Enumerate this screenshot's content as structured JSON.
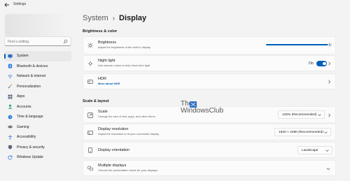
{
  "window": {
    "title": "Settings"
  },
  "search": {
    "placeholder": "Find a setting"
  },
  "sidebar": {
    "items": [
      {
        "label": "System",
        "icon": "system-icon",
        "active": true
      },
      {
        "label": "Bluetooth & devices",
        "icon": "bluetooth-icon"
      },
      {
        "label": "Network & internet",
        "icon": "network-icon"
      },
      {
        "label": "Personalization",
        "icon": "personalization-icon"
      },
      {
        "label": "Apps",
        "icon": "apps-icon"
      },
      {
        "label": "Accounts",
        "icon": "accounts-icon"
      },
      {
        "label": "Time & language",
        "icon": "time-language-icon"
      },
      {
        "label": "Gaming",
        "icon": "gaming-icon"
      },
      {
        "label": "Accessibility",
        "icon": "accessibility-icon"
      },
      {
        "label": "Privacy & security",
        "icon": "privacy-icon"
      },
      {
        "label": "Windows Update",
        "icon": "windows-update-icon"
      }
    ]
  },
  "breadcrumb": {
    "parent": "System",
    "separator": "›",
    "current": "Display"
  },
  "sections": {
    "brightness_color": "Brightness & color",
    "scale_layout": "Scale & layout"
  },
  "settings": {
    "brightness": {
      "title": "Brightness",
      "subtitle": "Adjust the brightness of the built-in display",
      "value_fraction": 0.99
    },
    "night_light": {
      "title": "Night light",
      "subtitle": "Use warmer colors to help block blue light",
      "state": "On",
      "on": true
    },
    "hdr": {
      "title": "HDR",
      "link": "More about HDR"
    },
    "scale": {
      "title": "Scale",
      "subtitle": "Change the size of text, apps, and other items",
      "value": "125% (Recommended)"
    },
    "resolution": {
      "title": "Display resolution",
      "subtitle": "Adjust the resolution to fit your connected display",
      "value": "1920 × 1080 (Recommended)"
    },
    "orientation": {
      "title": "Display orientation",
      "value": "Landscape"
    },
    "multiple_displays": {
      "title": "Multiple displays",
      "subtitle": "Choose the presentation mode for your displays"
    }
  },
  "watermark": {
    "line1": "The",
    "line2": "WindowsClub"
  },
  "colors": {
    "accent": "#005fb8",
    "background": "#f3f3f3",
    "card": "#fbfbfb"
  }
}
